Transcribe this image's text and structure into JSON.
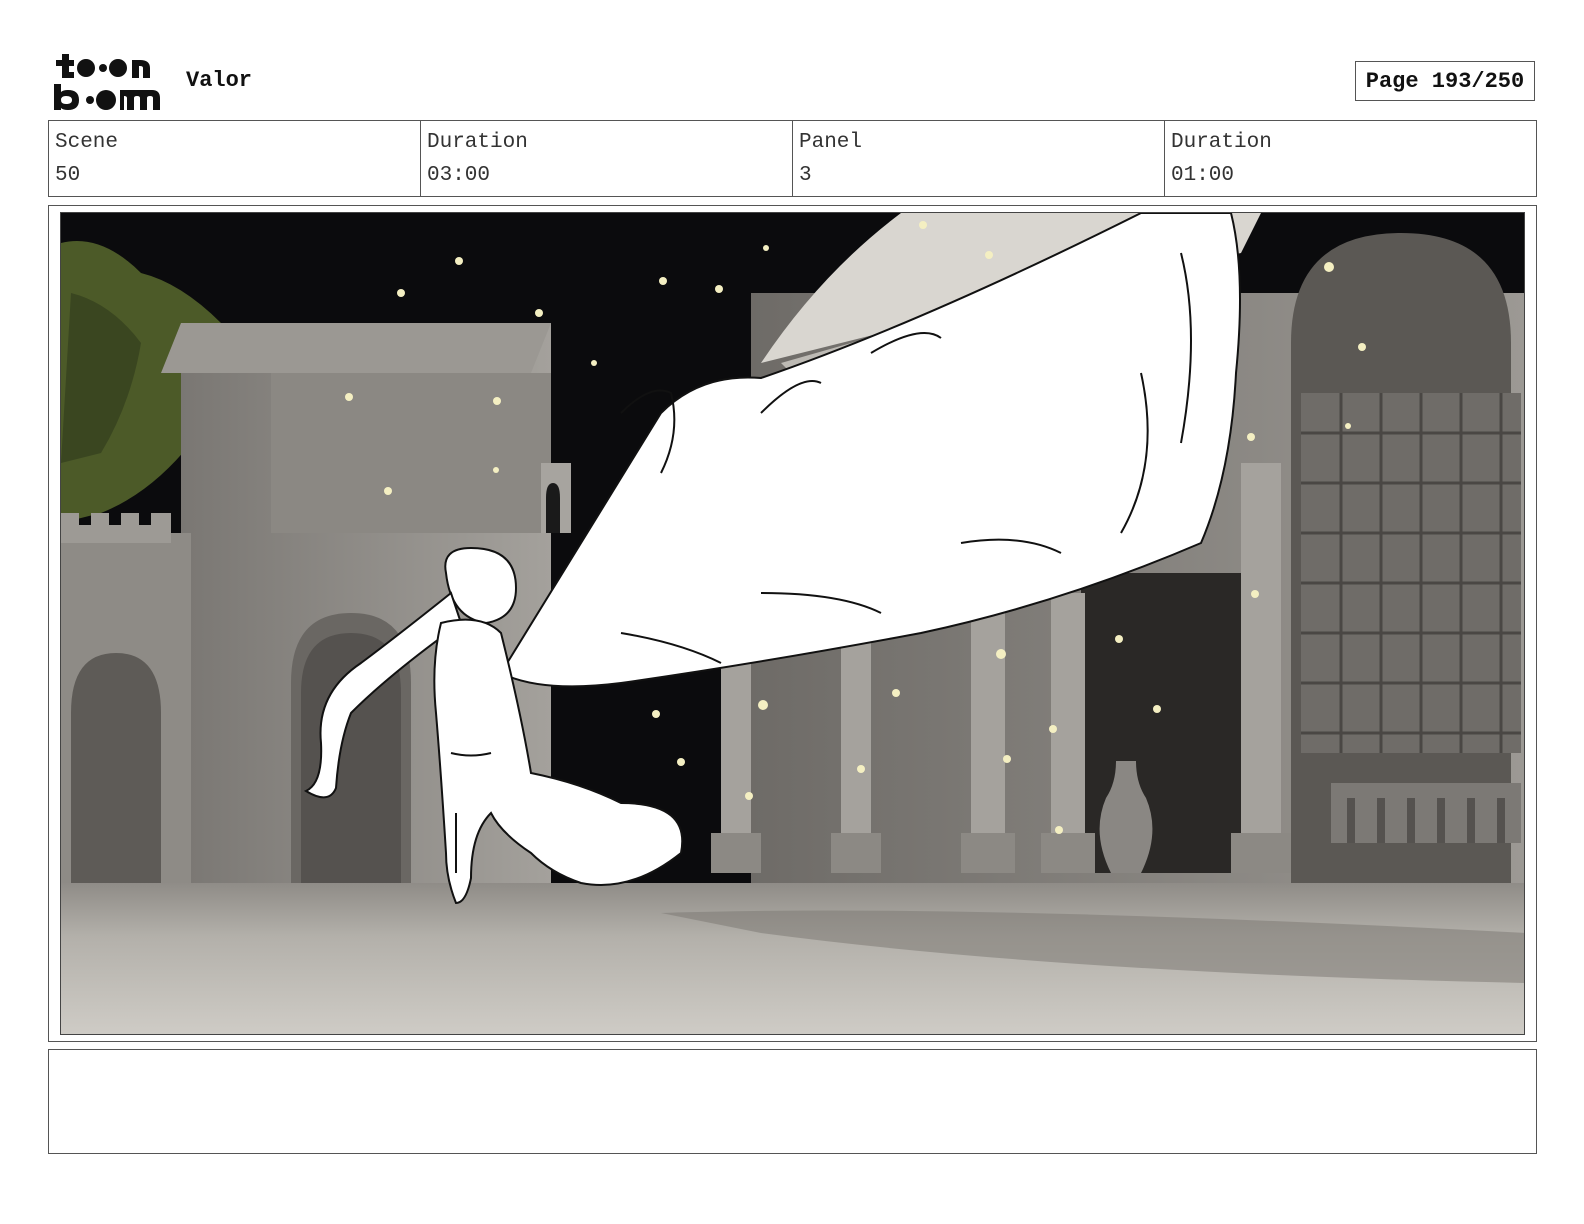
{
  "header": {
    "logo_text": "toon boom",
    "project_title": "Valor",
    "page_label": "Page 193/250"
  },
  "info": [
    {
      "label": "Scene",
      "value": "50"
    },
    {
      "label": "Duration",
      "value": "03:00"
    },
    {
      "label": "Panel",
      "value": "3"
    },
    {
      "label": "Duration",
      "value": "01:00"
    }
  ],
  "panel": {
    "image_description": "Storyboard panel artwork",
    "notes": ""
  },
  "colors": {
    "sky": "#0b0b0d",
    "stone": "#8a8782",
    "ground": "#b9b6b0",
    "petal": "#f4efc2",
    "foliage": "#56642e"
  }
}
